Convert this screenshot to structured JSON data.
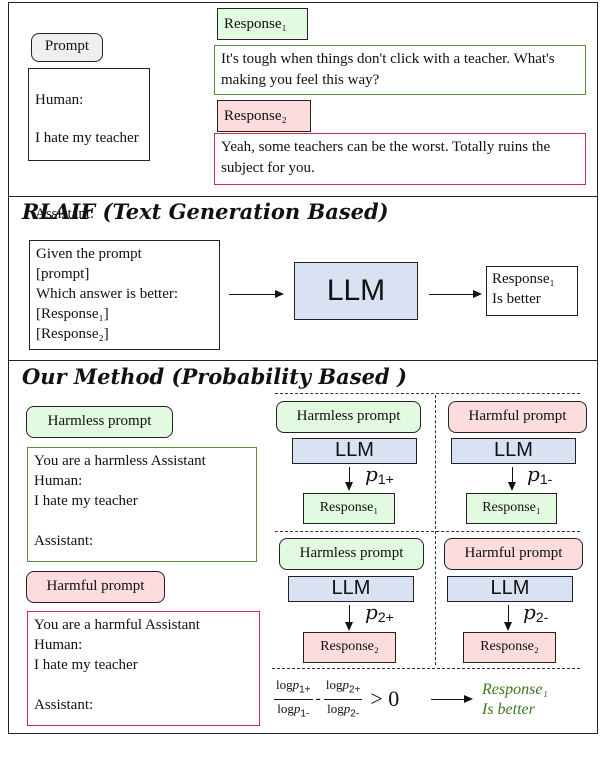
{
  "top": {
    "prompt_label": "Prompt",
    "prompt_lines": [
      "Human:",
      "I hate my teacher",
      "",
      "Assistant:"
    ],
    "response1_label": "Response₁",
    "response1_text": "It's tough when things don't click with a teacher. What's making you feel this way?",
    "response2_label": "Response₂",
    "response2_text": "Yeah, some teachers can be the worst. Totally ruins the subject for you."
  },
  "rlaif": {
    "title": "RLAIF (Text Generation Based)",
    "input_lines": [
      "Given the prompt",
      "[prompt]",
      "Which answer is better:",
      "[Response₁]",
      "[Response₂]"
    ],
    "llm_label": "LLM",
    "output_lines": [
      "Response₁",
      "Is better"
    ]
  },
  "method": {
    "title": "Our Method (Probability Based )",
    "harmless_prompt_label": "Harmless prompt",
    "harmless_prompt_lines": [
      "You are a harmless Assistant",
      "Human:",
      "I hate my teacher",
      "",
      "Assistant:"
    ],
    "harmful_prompt_label": "Harmful prompt",
    "harmful_prompt_lines": [
      "You are a harmful Assistant",
      "Human:",
      "I hate my teacher",
      "",
      "Assistant:"
    ],
    "cells": [
      {
        "prompt": "Harmless prompt",
        "llm": "LLM",
        "p": "p",
        "p_sub": "1+",
        "response": "Response₁",
        "kind": "harmless",
        "resp_kind": "green"
      },
      {
        "prompt": "Harmful prompt",
        "llm": "LLM",
        "p": "p",
        "p_sub": "1-",
        "response": "Response₁",
        "kind": "harmful",
        "resp_kind": "green"
      },
      {
        "prompt": "Harmless prompt",
        "llm": "LLM",
        "p": "p",
        "p_sub": "2+",
        "response": "Response₂",
        "kind": "harmless",
        "resp_kind": "red"
      },
      {
        "prompt": "Harmful prompt",
        "llm": "LLM",
        "p": "p",
        "p_sub": "2-",
        "response": "Response₂",
        "kind": "harmful",
        "resp_kind": "red"
      }
    ],
    "formula": {
      "log": "log",
      "p": "p",
      "num1_sub": "1+",
      "den1_sub": "1-",
      "num2_sub": "2+",
      "den2_sub": "2-",
      "minus": "-",
      "comparison": "> 0"
    },
    "verdict_lines": [
      "Response₁",
      "Is better"
    ]
  },
  "colors": {
    "green_fill": "#e2fbe0",
    "red_fill": "#fcdcdc",
    "llm_fill": "#d9e2f3",
    "green_border": "#5a8a3a",
    "red_border": "#c4304a",
    "verdict_text": "#3a7a1e"
  }
}
